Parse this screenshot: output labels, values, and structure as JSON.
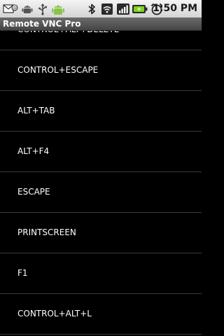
{
  "status_bar": {
    "icons": [
      "gmail-icon",
      "android-icon",
      "usb-icon",
      "android-debug-icon",
      "bluetooth-icon",
      "wifi-icon",
      "signal-icon",
      "battery-charging-icon",
      "alarm-icon"
    ],
    "time": "1:50 PM"
  },
  "app": {
    "title": "Remote VNC Pro"
  },
  "key_list": {
    "items": [
      {
        "label": "CONTROL+ALT+DELETE"
      },
      {
        "label": "CONTROL+ESCAPE"
      },
      {
        "label": "ALT+TAB"
      },
      {
        "label": "ALT+F4"
      },
      {
        "label": "ESCAPE"
      },
      {
        "label": "PRINTSCREEN"
      },
      {
        "label": "F1"
      },
      {
        "label": "CONTROL+ALT+L"
      }
    ]
  }
}
